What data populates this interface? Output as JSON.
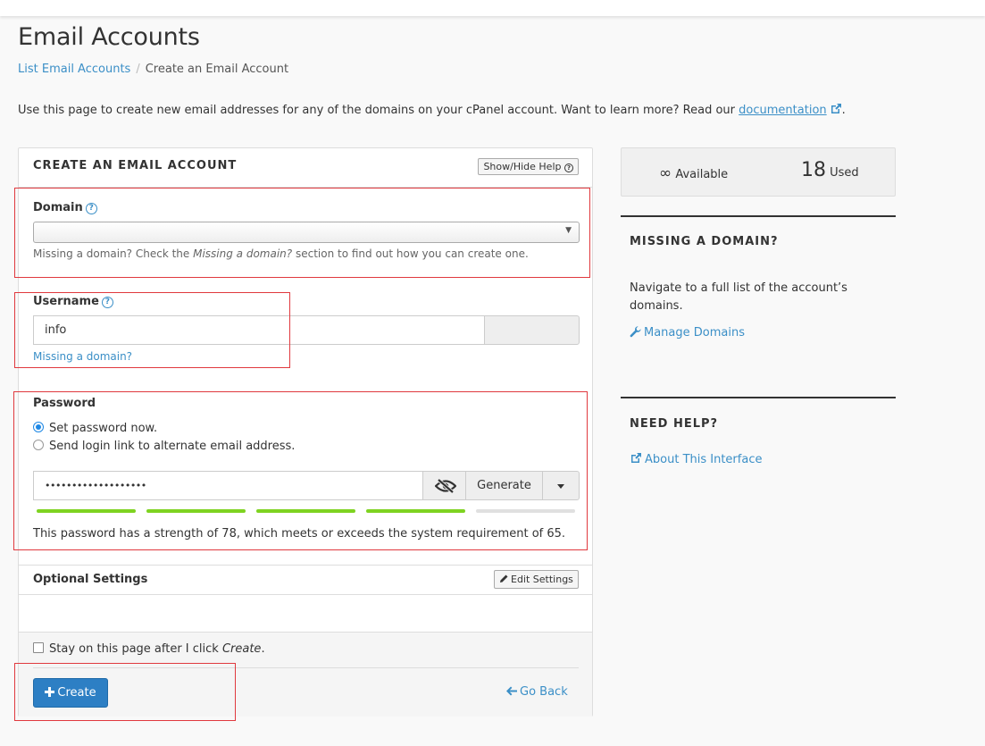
{
  "page": {
    "title": "Email Accounts",
    "breadcrumb": [
      "List Email Accounts",
      "Create an Email Account"
    ],
    "intro": "Use this page to create new email addresses for any of the domains on your cPanel account. Want to learn more? Read our",
    "intro_link": "documentation",
    "intro_end": "."
  },
  "form": {
    "title": "CREATE AN EMAIL ACCOUNT",
    "help_button": "Show/Hide Help",
    "domain": {
      "label": "Domain",
      "value": "",
      "help_before": "Missing a domain? Check the ",
      "help_em": "Missing a domain?",
      "help_after": " section to find out how you can create one."
    },
    "username": {
      "label": "Username",
      "value": "info",
      "link": "Missing a domain?"
    },
    "password": {
      "label": "Password",
      "option_now": "Set password now.",
      "option_link": "Send login link to alternate email address.",
      "value": "•••••••••••••••••••",
      "generate": "Generate",
      "strength_text": "This password has a strength of 78, which meets or exceeds the system requirement of 65.",
      "strength": 78,
      "requirement": 65,
      "meter_segments_filled": 4,
      "meter_segments_total": 5
    },
    "optional": {
      "title": "Optional Settings",
      "edit_button": "Edit Settings"
    },
    "stay_before": "Stay on this page after I click ",
    "stay_em": "Create",
    "stay_after": ".",
    "create_button": "Create",
    "go_back": "Go Back"
  },
  "sidebar": {
    "available_symbol": "∞",
    "available_label": "Available",
    "used_value": "18",
    "used_label": "Used",
    "missing_domain_title": "MISSING A DOMAIN?",
    "missing_domain_text": "Navigate to a full list of the account’s domains.",
    "manage_domains": "Manage Domains",
    "need_help_title": "NEED HELP?",
    "about_interface": "About This Interface"
  },
  "colors": {
    "link": "#3b8fc7",
    "primary_button": "#2d7fc4",
    "meter_on": "#7ed321",
    "highlight": "#e0393e"
  }
}
